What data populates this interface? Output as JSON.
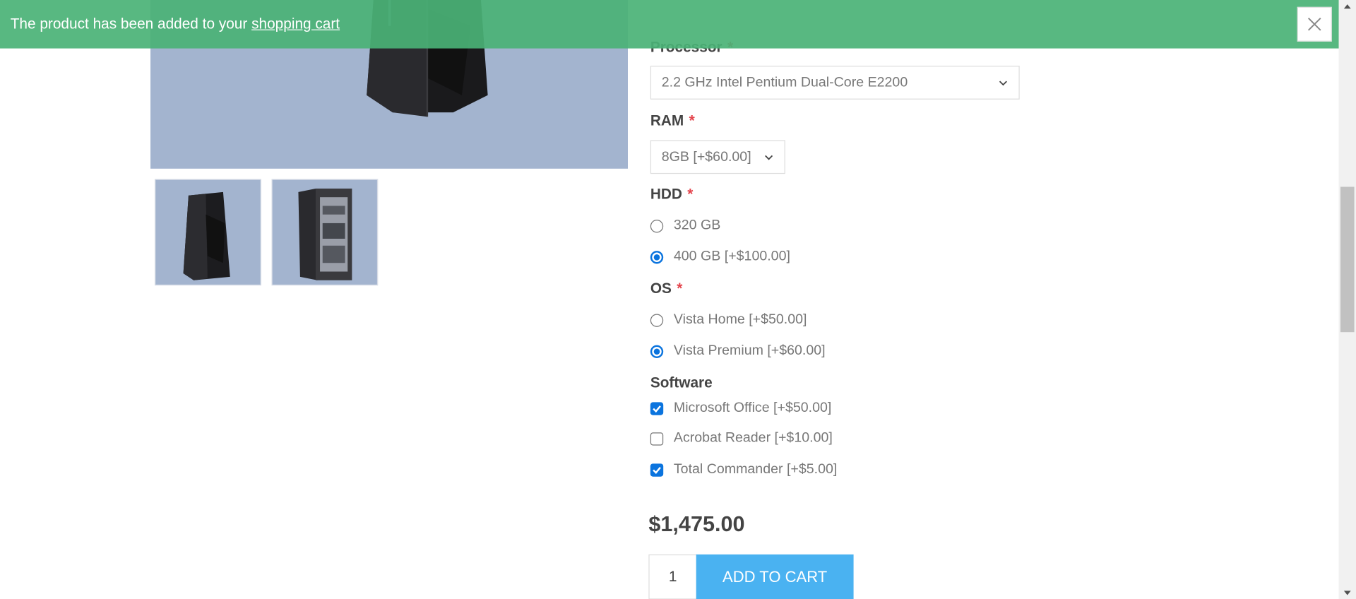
{
  "notification": {
    "text": "The product has been added to your ",
    "link": "shopping cart"
  },
  "attributes": {
    "processor": {
      "label": "Processor",
      "required": "*",
      "selected": "2.2 GHz Intel Pentium Dual-Core E2200"
    },
    "ram": {
      "label": "RAM",
      "required": "*",
      "selected": "8GB [+$60.00]"
    },
    "hdd": {
      "label": "HDD",
      "required": "*",
      "options": [
        {
          "label": "320 GB",
          "checked": false
        },
        {
          "label": "400 GB [+$100.00]",
          "checked": true
        }
      ]
    },
    "os": {
      "label": "OS",
      "required": "*",
      "options": [
        {
          "label": "Vista Home [+$50.00]",
          "checked": false
        },
        {
          "label": "Vista Premium [+$60.00]",
          "checked": true
        }
      ]
    },
    "software": {
      "label": "Software",
      "options": [
        {
          "label": "Microsoft Office [+$50.00]",
          "checked": true
        },
        {
          "label": "Acrobat Reader [+$10.00]",
          "checked": false
        },
        {
          "label": "Total Commander [+$5.00]",
          "checked": true
        }
      ]
    }
  },
  "price": "$1,475.00",
  "quantity": "1",
  "add_to_cart_label": "ADD TO CART",
  "colors": {
    "notification_bg": "#4ab276",
    "accent_button": "#4ab2f1",
    "required": "#e4434b",
    "image_bg": "#a3b4cf"
  }
}
